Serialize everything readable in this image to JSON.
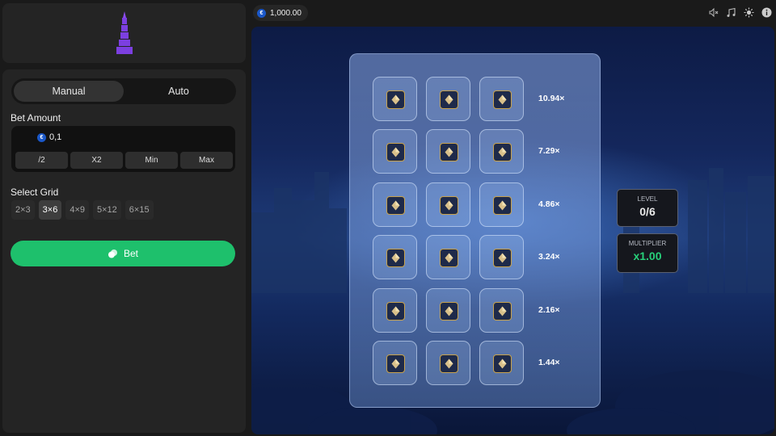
{
  "header": {
    "balance": "1,000.00",
    "currency_symbol": "€",
    "icons": [
      "volume-icon",
      "music-icon",
      "brightness-icon",
      "info-icon"
    ]
  },
  "logo": {
    "icon": "tower-icon",
    "color": "#7c3fe0"
  },
  "mode": {
    "tabs": [
      "Manual",
      "Auto"
    ],
    "active": "Manual"
  },
  "bet": {
    "label": "Bet Amount",
    "value": "0,1",
    "currency_symbol": "€",
    "buttons": [
      "/2",
      "X2",
      "Min",
      "Max"
    ]
  },
  "grid": {
    "label": "Select Grid",
    "options": [
      "2×3",
      "3×6",
      "4×9",
      "5×12",
      "6×15"
    ],
    "active": "3×6"
  },
  "bet_button": {
    "label": "Bet",
    "color": "#1ec06c"
  },
  "board": {
    "columns": 3,
    "rows": 6,
    "tile_icon": "diamond-icon",
    "multipliers": [
      "10.94×",
      "7.29×",
      "4.86×",
      "3.24×",
      "2.16×",
      "1.44×"
    ]
  },
  "stats": {
    "level_label": "LEVEL",
    "level_value": "0/6",
    "multiplier_label": "MULTIPLIER",
    "multiplier_value": "x1.00",
    "multiplier_color": "#27d07a"
  }
}
